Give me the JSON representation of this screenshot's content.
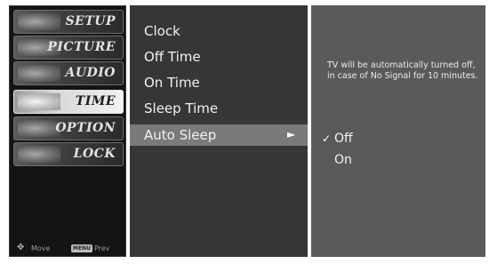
{
  "categories": [
    {
      "label": "SETUP",
      "active": false
    },
    {
      "label": "PICTURE",
      "active": false
    },
    {
      "label": "AUDIO",
      "active": false
    },
    {
      "label": "TIME",
      "active": true
    },
    {
      "label": "OPTION",
      "active": false
    },
    {
      "label": "LOCK",
      "active": false
    }
  ],
  "footer": {
    "move_label": "Move",
    "menu_key": "MENU",
    "prev_label": "Prev"
  },
  "items": [
    {
      "label": "Clock"
    },
    {
      "label": "Off Time"
    },
    {
      "label": "On Time"
    },
    {
      "label": "Sleep Time"
    },
    {
      "label": "Auto Sleep",
      "selected": true
    }
  ],
  "arrow_glyph": "►",
  "description": "TV will be automatically turned off, in case of No Signal for 10 minutes.",
  "options": [
    {
      "label": "Off",
      "checked": true
    },
    {
      "label": "On",
      "checked": false
    }
  ],
  "check_glyph": "✓",
  "colors": {
    "highlight": "#7a7a7a",
    "active_category": "#e6e6e6"
  }
}
